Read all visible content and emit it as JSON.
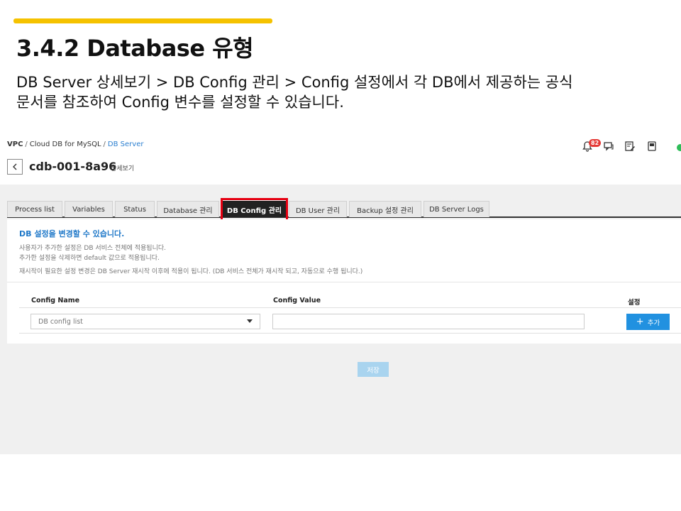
{
  "slide": {
    "title": "3.4.2 Database 유형",
    "description_line1": "DB Server 상세보기 > DB Config 관리 > Config 설정에서 각 DB에서 제공하는 공식",
    "description_line2": "문서를 참조하여 Config 변수를 설정할 수 있습니다.",
    "accent_color": "#f5c200"
  },
  "breadcrumb": {
    "items": [
      "VPC",
      "Cloud DB for MySQL",
      "DB Server"
    ],
    "separator": "/"
  },
  "top_icons": {
    "notification_count": "82",
    "icons": [
      "bell-icon",
      "chat-icon",
      "edit-icon",
      "book-icon",
      "status-icon"
    ]
  },
  "header": {
    "server_name": "cdb-001-8a96",
    "detail_label": "상세보기"
  },
  "tabs": [
    {
      "label": "Process list",
      "active": false
    },
    {
      "label": "Variables",
      "active": false
    },
    {
      "label": "Status",
      "active": false
    },
    {
      "label": "Database 관리",
      "active": false
    },
    {
      "label": "DB Config 관리",
      "active": true
    },
    {
      "label": "DB User 관리",
      "active": false
    },
    {
      "label": "Backup 설정 관리",
      "active": false
    },
    {
      "label": "DB Server Logs",
      "active": false
    }
  ],
  "info": {
    "title": "DB 설정을 변경할 수 있습니다.",
    "lines": [
      "사용자가 추가한 설정은 DB 서비스 전체에 적용됩니다.",
      "추가한 설정을 삭제하면 default 값으로 적용됩니다.",
      "재시작이 필요한 설정 변경은 DB Server 재시작 이후에 적용이 됩니다. (DB 서비스 전체가 재시작 되고, 자동으로 수행 됩니다.)"
    ]
  },
  "config_table": {
    "columns": [
      "Config Name",
      "Config Value",
      "설정"
    ],
    "select_value": "DB config list",
    "value_input": "",
    "add_button": "추가"
  },
  "save_button": "저장",
  "colors": {
    "highlight": "#e60012",
    "link": "#2b7fd0",
    "primary_button": "#2191e0",
    "disabled_button": "#a9d4ef",
    "badge": "#e53935"
  }
}
